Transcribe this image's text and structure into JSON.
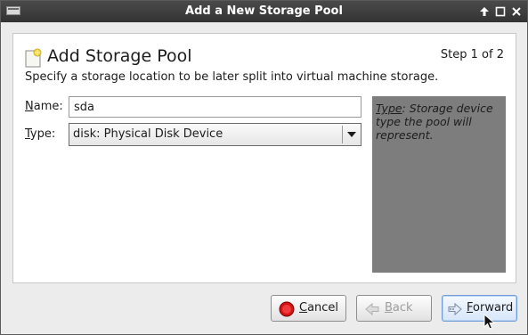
{
  "window": {
    "title": "Add a New Storage Pool",
    "controls": [
      "menu-icon",
      "maximize-icon",
      "minimize-icon",
      "close-icon"
    ]
  },
  "header": {
    "title": "Add Storage Pool",
    "step": "Step 1 of 2",
    "subtitle": "Specify a storage location to be later split into virtual machine storage.",
    "icon": "storage-pool-icon"
  },
  "form": {
    "name_label_mnemonic": "N",
    "name_label_rest": "ame:",
    "name_value": "sda",
    "type_label_mnemonic": "T",
    "type_label_rest": "ype:",
    "type_value": "disk: Physical Disk Device"
  },
  "description": {
    "label": "Type",
    "text": ": Storage device type the pool will represent."
  },
  "buttons": {
    "cancel_mnemonic": "C",
    "cancel_rest": "ancel",
    "back_mnemonic": "B",
    "back_rest": "ack",
    "forward_mnemonic": "F",
    "forward_rest": "orward",
    "cancel_icon": "stop-icon",
    "back_icon": "back-arrow-icon",
    "forward_icon": "forward-arrow-icon",
    "back_disabled": true
  }
}
